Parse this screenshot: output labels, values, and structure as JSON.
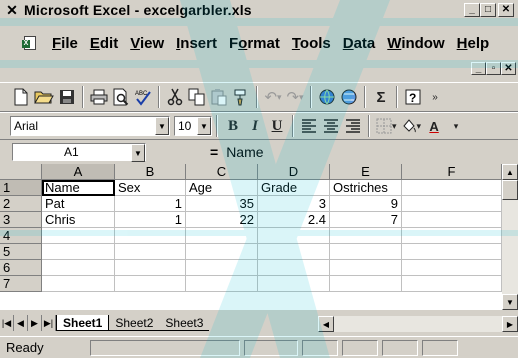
{
  "window": {
    "title": "Microsoft Excel - excelgarbler.xls",
    "app_icon": "excel-x-icon",
    "buttons": {
      "minimize": "_",
      "maximize": "□",
      "close": "✕"
    }
  },
  "menubar": {
    "items": [
      {
        "label": "File",
        "key": "F"
      },
      {
        "label": "Edit",
        "key": "E"
      },
      {
        "label": "View",
        "key": "V"
      },
      {
        "label": "Insert",
        "key": "I"
      },
      {
        "label": "Format",
        "key": "o"
      },
      {
        "label": "Tools",
        "key": "T"
      },
      {
        "label": "Data",
        "key": "D"
      },
      {
        "label": "Window",
        "key": "W"
      },
      {
        "label": "Help",
        "key": "H"
      }
    ],
    "doc_buttons": {
      "minimize": "_",
      "restore": "▫",
      "close": "✕"
    }
  },
  "formatting": {
    "font": "Arial",
    "size": "10",
    "bold": "B",
    "italic": "I",
    "underline": "U"
  },
  "formula_bar": {
    "name_box": "A1",
    "equals": "=",
    "content": "Name"
  },
  "grid": {
    "columns": [
      "A",
      "B",
      "C",
      "D",
      "E",
      "F"
    ],
    "rows": [
      {
        "num": "1",
        "cells": [
          "Name",
          "Sex",
          "Age",
          "Grade",
          "Ostriches",
          ""
        ]
      },
      {
        "num": "2",
        "cells": [
          "Pat",
          "1",
          "35",
          "3",
          "9",
          ""
        ]
      },
      {
        "num": "3",
        "cells": [
          "Chris",
          "1",
          "22",
          "2.4",
          "7",
          ""
        ]
      },
      {
        "num": "4",
        "cells": [
          "",
          "",
          "",
          "",
          "",
          ""
        ]
      },
      {
        "num": "5",
        "cells": [
          "",
          "",
          "",
          "",
          "",
          ""
        ]
      },
      {
        "num": "6",
        "cells": [
          "",
          "",
          "",
          "",
          "",
          ""
        ]
      },
      {
        "num": "7",
        "cells": [
          "",
          "",
          "",
          "",
          "",
          ""
        ]
      }
    ],
    "selected_cell": "A1"
  },
  "sheets": {
    "tabs": [
      "Sheet1",
      "Sheet2",
      "Sheet3"
    ],
    "active": "Sheet1"
  },
  "status": {
    "text": "Ready"
  },
  "colors": {
    "chrome": "#d4d0c8",
    "watermark": "#00bcd4",
    "grid_line": "#c0c0c0"
  }
}
